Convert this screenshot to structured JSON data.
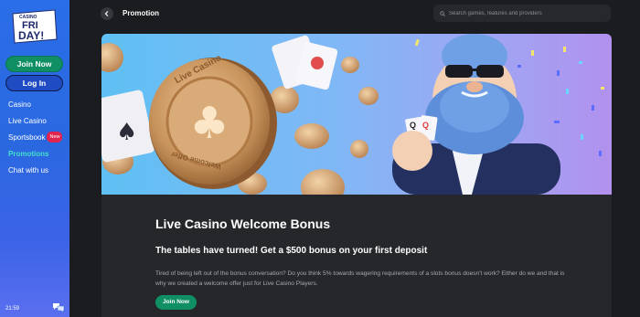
{
  "brand": {
    "logo_top": "CASINO",
    "logo_line1": "FRI",
    "logo_line2": "DAY!"
  },
  "sidebar": {
    "join_label": "Join Now",
    "login_label": "Log In",
    "items": [
      {
        "label": "Casino"
      },
      {
        "label": "Live Casino"
      },
      {
        "label": "Sportsbook",
        "badge": "New"
      },
      {
        "label": "Promotions"
      },
      {
        "label": "Chat with us"
      }
    ],
    "time": "21:59"
  },
  "header": {
    "title": "Promotion",
    "search_placeholder": "Search games, features and providers"
  },
  "promo": {
    "coin_text": "Live Casino",
    "coin_text_bottom": "Welcome Offer",
    "title": "Live Casino Welcome Bonus",
    "subtitle": "The tables have turned! Get a $500 bonus on your first deposit",
    "description": "Tired of being left out of the bonus conversation? Do you think 5% towards wagering requirements of a slots bonus doesn't work? Either do we and that is why we created a welcome offer just for Live Casino Players.",
    "button_label": "Join Now"
  },
  "colors": {
    "accent_green": "#0f8f63",
    "sidebar_blue": "#2a6ee8",
    "active_nav": "#45e0c9",
    "badge_red": "#e0264f"
  }
}
